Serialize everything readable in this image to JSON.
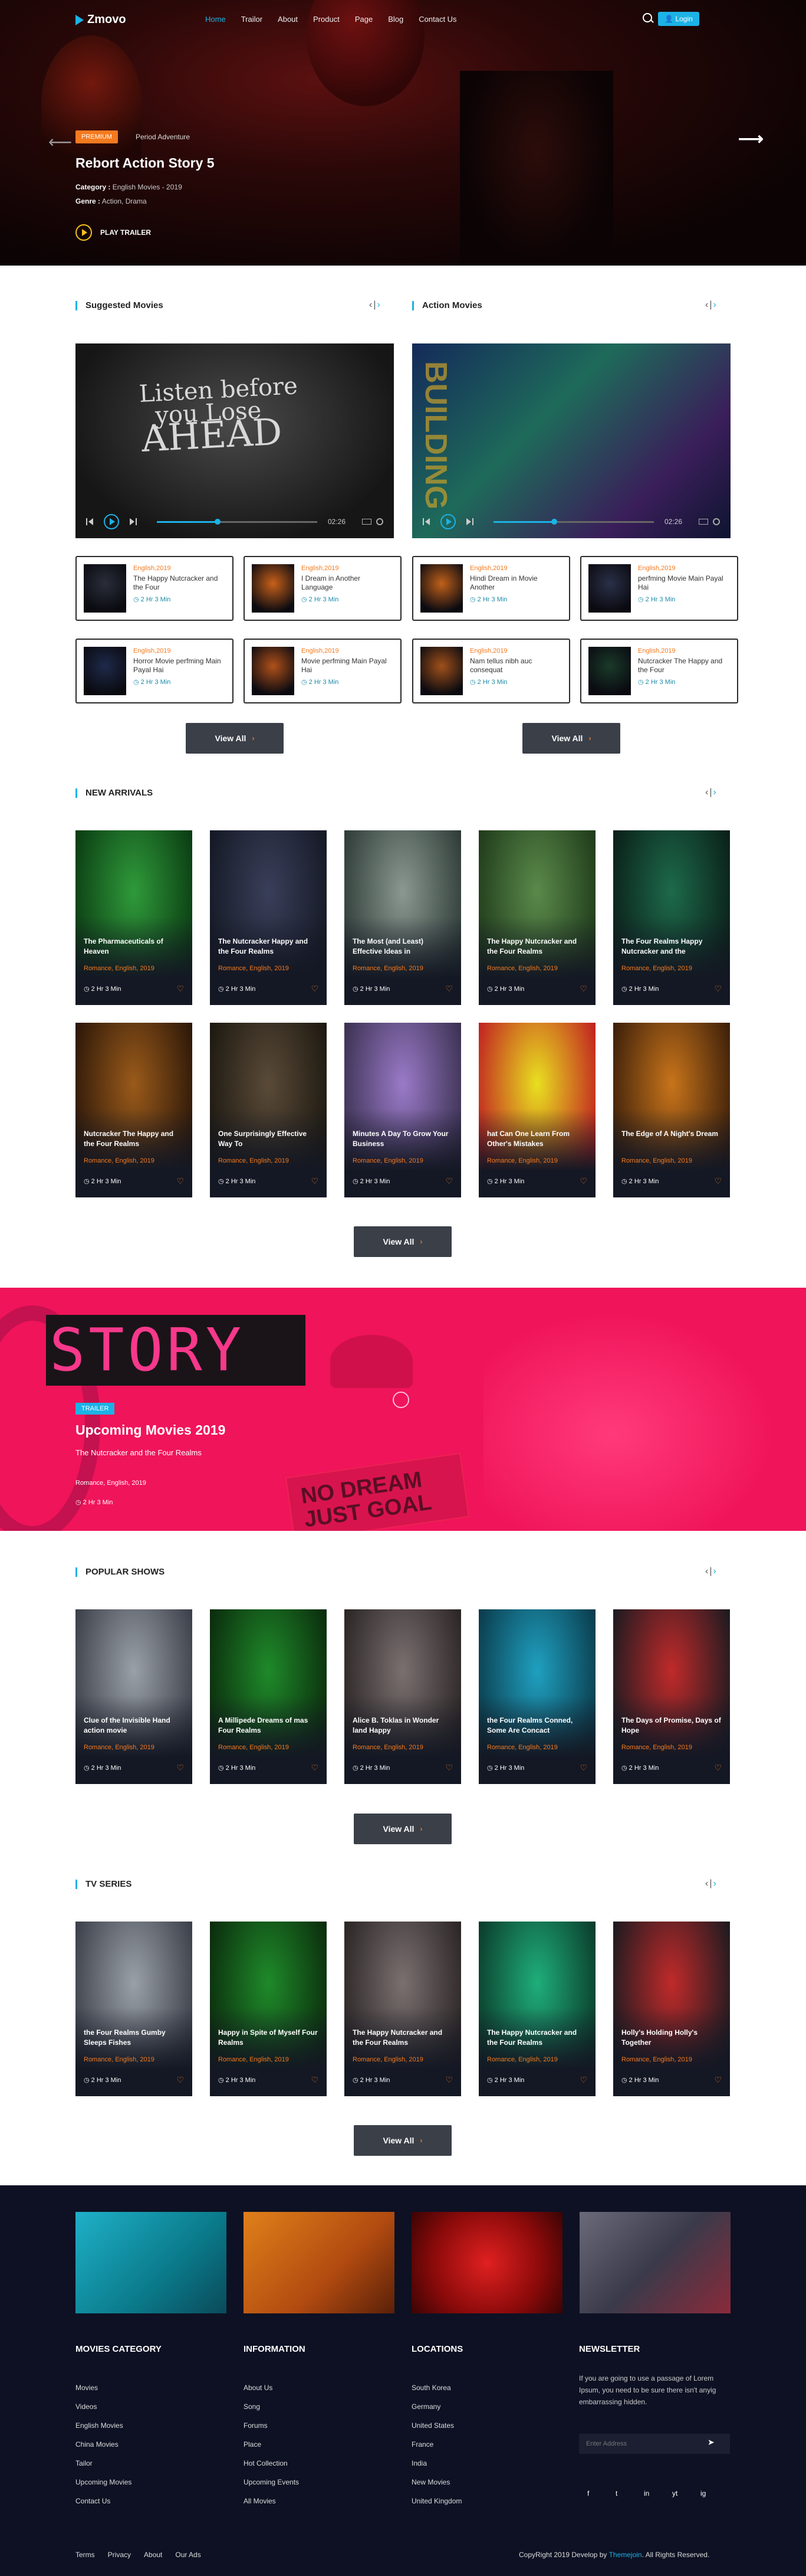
{
  "header": {
    "logo": "Zmovo",
    "nav": [
      "Home",
      "Trailor",
      "About",
      "Product",
      "Page",
      "Blog",
      "Contact Us"
    ],
    "login": "Login"
  },
  "hero": {
    "badge": "PREMIUM",
    "category_tag": "Period Adventure",
    "title": "Rebort Action Story 5",
    "category_label": "Category :",
    "category_value": "English Movies - 2019",
    "genre_label": "Genre :",
    "genre_value": "Action, Drama",
    "play_label": "PLAY TRAILER"
  },
  "suggested": {
    "title": "Suggested Movies",
    "video_time": "02:26",
    "progress": 0.38,
    "cards": [
      {
        "year": "English,2019",
        "name": "The Happy Nutcracker and the Four",
        "dur": "2 Hr 3 Min"
      },
      {
        "year": "English,2019",
        "name": "I Dream in Another Language",
        "dur": "2 Hr 3 Min"
      },
      {
        "year": "English,2019",
        "name": "Horror Movie perfming Main Payal Hai",
        "dur": "2 Hr 3 Min"
      },
      {
        "year": "English,2019",
        "name": "Movie perfming Main Payal Hai",
        "dur": "2 Hr 3 Min"
      }
    ],
    "view_all": "View All"
  },
  "action": {
    "title": "Action Movies",
    "video_time": "02:26",
    "progress": 0.38,
    "cards": [
      {
        "year": "English,2019",
        "name": "Hindi Dream in Movie Another",
        "dur": "2 Hr 3 Min"
      },
      {
        "year": "English,2019",
        "name": "perfming Movie Main Payal Hai",
        "dur": "2 Hr 3 Min"
      },
      {
        "year": "English,2019",
        "name": "Nam tellus nibh auc consequat",
        "dur": "2 Hr 3 Min"
      },
      {
        "year": "English,2019",
        "name": "Nutcracker The Happy and the Four",
        "dur": "2 Hr 3 Min"
      }
    ],
    "view_all": "View All"
  },
  "new_arrivals": {
    "title": "NEW ARRIVALS",
    "items": [
      {
        "name": "The Pharmaceuticals of Heaven",
        "meta": "Romance, English, 2019",
        "dur": "2 Hr 3 Min",
        "c1": "#2f9a3a",
        "c2": "#0a3a12"
      },
      {
        "name": "The Nutcracker Happy and the Four Realms",
        "meta": "Romance, English, 2019",
        "dur": "2 Hr 3 Min",
        "c1": "#3a3f5a",
        "c2": "#141824"
      },
      {
        "name": "The Most (and Least) Effective Ideas in",
        "meta": "Romance, English, 2019",
        "dur": "2 Hr 3 Min",
        "c1": "#8a9890",
        "c2": "#2d3a36"
      },
      {
        "name": "The Happy Nutcracker and the Four Realms",
        "meta": "Romance, English, 2019",
        "dur": "2 Hr 3 Min",
        "c1": "#5a8a4a",
        "c2": "#1f3a1a"
      },
      {
        "name": "The Four Realms Happy Nutcracker and the",
        "meta": "Romance, English, 2019",
        "dur": "2 Hr 3 Min",
        "c1": "#1d6a4a",
        "c2": "#0a1e18"
      },
      {
        "name": "Nutcracker The Happy and the Four Realms",
        "meta": "Romance, English, 2019",
        "dur": "2 Hr 3 Min",
        "c1": "#9a5a1a",
        "c2": "#2a1608"
      },
      {
        "name": "One Surprisingly Effective Way To",
        "meta": "Romance, English, 2019",
        "dur": "2 Hr 3 Min",
        "c1": "#5a4a38",
        "c2": "#1c1810"
      },
      {
        "name": "Minutes A Day To Grow Your Business",
        "meta": "Romance, English, 2019",
        "dur": "2 Hr 3 Min",
        "c1": "#9a7ac8",
        "c2": "#3a3050"
      },
      {
        "name": "hat Can One Learn From Other's Mistakes",
        "meta": "Romance, English, 2019",
        "dur": "2 Hr 3 Min",
        "c1": "#e8e020",
        "c2": "#c02020"
      },
      {
        "name": "The Edge of A Night's Dream",
        "meta": "Romance, English, 2019",
        "dur": "2 Hr 3 Min",
        "c1": "#c8741a",
        "c2": "#3a1e0a"
      }
    ],
    "view_all": "View All"
  },
  "trailer_band": {
    "badge": "TRAILER",
    "title": "Upcoming Movies 2019",
    "subtitle": "The Nutcracker and the Four Realms",
    "meta": "Romance, English, 2019",
    "dur": "2 Hr 3 Min",
    "bg_text": "STORY",
    "glass_text": "NO DREAM JUST GOAL"
  },
  "popular": {
    "title": "POPULAR SHOWS",
    "items": [
      {
        "name": "Clue of the Invisible Hand action movie",
        "meta": "Romance, English, 2019",
        "dur": "2 Hr 3 Min",
        "c1": "#9aa0a8",
        "c2": "#3a3e48"
      },
      {
        "name": "A Millipede Dreams of mas Four Realms",
        "meta": "Romance, English, 2019",
        "dur": "2 Hr 3 Min",
        "c1": "#1f8a2a",
        "c2": "#0a2a0c"
      },
      {
        "name": "Alice B. Toklas in Wonder land Happy",
        "meta": "Romance, English, 2019",
        "dur": "2 Hr 3 Min",
        "c1": "#7a7070",
        "c2": "#2a2424"
      },
      {
        "name": "the Four Realms Conned, Some Are Concact",
        "meta": "Romance, English, 2019",
        "dur": "2 Hr 3 Min",
        "c1": "#1fa0c0",
        "c2": "#0a3a4a"
      },
      {
        "name": "The Days of Promise, Days of Hope",
        "meta": "Romance, English, 2019",
        "dur": "2 Hr 3 Min",
        "c1": "#c02a2a",
        "c2": "#1a1a20"
      }
    ],
    "view_all": "View All"
  },
  "tv_series": {
    "title": "TV SERIES",
    "items": [
      {
        "name": "the Four Realms Gumby Sleeps Fishes",
        "meta": "Romance, English, 2019",
        "dur": "2 Hr 3 Min",
        "c1": "#9aa0a8",
        "c2": "#3a3e48"
      },
      {
        "name": "Happy in Spite of Myself Four Realms",
        "meta": "Romance, English, 2019",
        "dur": "2 Hr 3 Min",
        "c1": "#1f8a2a",
        "c2": "#0a2a0c"
      },
      {
        "name": "The Happy Nutcracker and the Four Realms",
        "meta": "Romance, English, 2019",
        "dur": "2 Hr 3 Min",
        "c1": "#7a7070",
        "c2": "#2a2424"
      },
      {
        "name": "The Happy Nutcracker and the Four Realms",
        "meta": "Romance, English, 2019",
        "dur": "2 Hr 3 Min",
        "c1": "#1fae7a",
        "c2": "#0a3a2a"
      },
      {
        "name": "Holly's Holding Holly's Together",
        "meta": "Romance, English, 2019",
        "dur": "2 Hr 3 Min",
        "c1": "#c02a2a",
        "c2": "#1a1a20"
      }
    ],
    "view_all": "View All"
  },
  "footer": {
    "cols": [
      {
        "title": "MOVIES CATEGORY",
        "items": [
          "Movies",
          "Videos",
          "English Movies",
          "China Movies",
          "Tailor",
          "Upcoming Movies",
          "Contact Us"
        ]
      },
      {
        "title": "INFORMATION",
        "items": [
          "About Us",
          "Song",
          "Forums",
          "Place",
          "Hot Collection",
          "Upcoming Events",
          "All Movies"
        ]
      },
      {
        "title": "LOCATIONS",
        "items": [
          "South Korea",
          "Germany",
          "United States",
          "France",
          "India",
          "New Movies",
          "United Kingdom"
        ]
      }
    ],
    "newsletter_title": "NEWSLETTER",
    "newsletter_text": "If you are going to use a passage of Lorem Ipsum, you need to be sure there isn't anyig embarrassing hidden.",
    "email_placeholder": "Enter Address",
    "social": [
      "f",
      "t",
      "in",
      "yt",
      "ig"
    ],
    "bottom_links": [
      "Terms",
      "Privacy",
      "About",
      "Our Ads"
    ],
    "copyright_pre": "CopyRight 2019 Develop by",
    "copyright_brand": "Themejoin",
    "copyright_post": ". All Rights Reserved."
  },
  "colors": {
    "accent": "#1cb2e6",
    "orange": "#f47a1f",
    "band": "#f0145a",
    "footer": "#0d1123"
  }
}
